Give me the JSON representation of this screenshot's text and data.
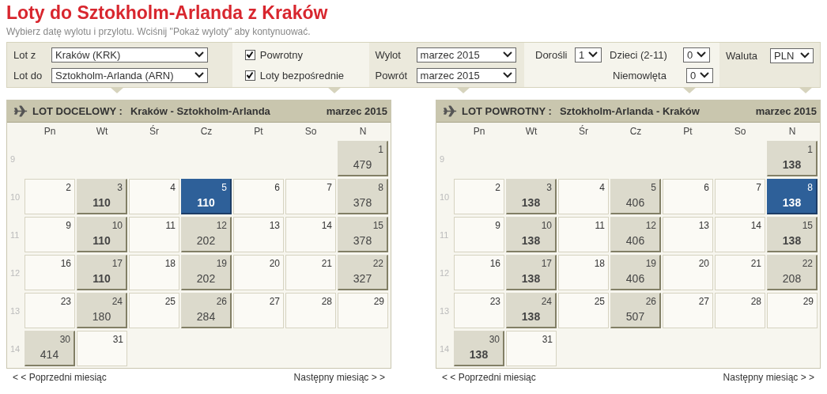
{
  "title": "Loty do Sztokholm-Arlanda z Kraków",
  "subtitle": "Wybierz datę wylotu i przylotu. Wciśnij \"Pokaż wyloty\" aby kontynuować.",
  "filters": {
    "route": [
      {
        "label": "Lot z",
        "value": "Kraków (KRK)"
      },
      {
        "label": "Lot do",
        "value": "Sztokholm-Arlanda (ARN)"
      }
    ],
    "options": [
      {
        "label": "Powrotny",
        "checked": true
      },
      {
        "label": "Loty bezpośrednie",
        "checked": true
      }
    ],
    "dates": [
      {
        "label": "Wylot",
        "value": "marzec 2015"
      },
      {
        "label": "Powrót",
        "value": "marzec 2015"
      }
    ],
    "passengers": [
      {
        "label": "Dorośli",
        "value": "1"
      },
      {
        "label": "Dzieci (2-11)",
        "value": "0"
      },
      {
        "label": "Niemowlęta",
        "value": "0"
      }
    ],
    "currency": {
      "label": "Waluta",
      "value": "PLN"
    }
  },
  "calendars": [
    {
      "heading": "LOT DOCELOWY :",
      "route": "Kraków - Sztokholm-Arlanda",
      "month": "marzec 2015",
      "weekdays": [
        "Pn",
        "Wt",
        "Śr",
        "Cz",
        "Pt",
        "So",
        "N"
      ],
      "weeks": [
        {
          "week": "9",
          "days": [
            {
              "kind": "blank"
            },
            {
              "kind": "blank"
            },
            {
              "kind": "blank"
            },
            {
              "kind": "blank"
            },
            {
              "kind": "blank"
            },
            {
              "kind": "blank"
            },
            {
              "kind": "flight",
              "day": "1",
              "price": "479",
              "cheapest": false,
              "selected": false
            }
          ]
        },
        {
          "week": "10",
          "days": [
            {
              "kind": "none",
              "day": "2"
            },
            {
              "kind": "flight",
              "day": "3",
              "price": "110",
              "cheapest": true,
              "selected": false
            },
            {
              "kind": "none",
              "day": "4"
            },
            {
              "kind": "flight",
              "day": "5",
              "price": "110",
              "cheapest": true,
              "selected": true
            },
            {
              "kind": "none",
              "day": "6"
            },
            {
              "kind": "none",
              "day": "7"
            },
            {
              "kind": "flight",
              "day": "8",
              "price": "378",
              "cheapest": false,
              "selected": false
            }
          ]
        },
        {
          "week": "11",
          "days": [
            {
              "kind": "none",
              "day": "9"
            },
            {
              "kind": "flight",
              "day": "10",
              "price": "110",
              "cheapest": true,
              "selected": false
            },
            {
              "kind": "none",
              "day": "11"
            },
            {
              "kind": "flight",
              "day": "12",
              "price": "202",
              "cheapest": false,
              "selected": false
            },
            {
              "kind": "none",
              "day": "13"
            },
            {
              "kind": "none",
              "day": "14"
            },
            {
              "kind": "flight",
              "day": "15",
              "price": "378",
              "cheapest": false,
              "selected": false
            }
          ]
        },
        {
          "week": "12",
          "days": [
            {
              "kind": "none",
              "day": "16"
            },
            {
              "kind": "flight",
              "day": "17",
              "price": "110",
              "cheapest": true,
              "selected": false
            },
            {
              "kind": "none",
              "day": "18"
            },
            {
              "kind": "flight",
              "day": "19",
              "price": "202",
              "cheapest": false,
              "selected": false
            },
            {
              "kind": "none",
              "day": "20"
            },
            {
              "kind": "none",
              "day": "21"
            },
            {
              "kind": "flight",
              "day": "22",
              "price": "327",
              "cheapest": false,
              "selected": false
            }
          ]
        },
        {
          "week": "13",
          "days": [
            {
              "kind": "none",
              "day": "23"
            },
            {
              "kind": "flight",
              "day": "24",
              "price": "180",
              "cheapest": false,
              "selected": false
            },
            {
              "kind": "none",
              "day": "25"
            },
            {
              "kind": "flight",
              "day": "26",
              "price": "284",
              "cheapest": false,
              "selected": false
            },
            {
              "kind": "none",
              "day": "27"
            },
            {
              "kind": "none",
              "day": "28"
            },
            {
              "kind": "none",
              "day": "29"
            }
          ]
        },
        {
          "week": "14",
          "days": [
            {
              "kind": "flight",
              "day": "30",
              "price": "414",
              "cheapest": false,
              "selected": false
            },
            {
              "kind": "none",
              "day": "31"
            }
          ]
        }
      ],
      "prev": "< < Poprzedni miesiąc",
      "next": "Następny miesiąc > >"
    },
    {
      "heading": "LOT POWROTNY :",
      "route": "Sztokholm-Arlanda - Kraków",
      "month": "marzec 2015",
      "weekdays": [
        "Pn",
        "Wt",
        "Śr",
        "Cz",
        "Pt",
        "So",
        "N"
      ],
      "weeks": [
        {
          "week": "9",
          "days": [
            {
              "kind": "blank"
            },
            {
              "kind": "blank"
            },
            {
              "kind": "blank"
            },
            {
              "kind": "blank"
            },
            {
              "kind": "blank"
            },
            {
              "kind": "blank"
            },
            {
              "kind": "flight",
              "day": "1",
              "price": "138",
              "cheapest": true,
              "selected": false
            }
          ]
        },
        {
          "week": "10",
          "days": [
            {
              "kind": "none",
              "day": "2"
            },
            {
              "kind": "flight",
              "day": "3",
              "price": "138",
              "cheapest": true,
              "selected": false
            },
            {
              "kind": "none",
              "day": "4"
            },
            {
              "kind": "flight",
              "day": "5",
              "price": "406",
              "cheapest": false,
              "selected": false
            },
            {
              "kind": "none",
              "day": "6"
            },
            {
              "kind": "none",
              "day": "7"
            },
            {
              "kind": "flight",
              "day": "8",
              "price": "138",
              "cheapest": true,
              "selected": true
            }
          ]
        },
        {
          "week": "11",
          "days": [
            {
              "kind": "none",
              "day": "9"
            },
            {
              "kind": "flight",
              "day": "10",
              "price": "138",
              "cheapest": true,
              "selected": false
            },
            {
              "kind": "none",
              "day": "11"
            },
            {
              "kind": "flight",
              "day": "12",
              "price": "406",
              "cheapest": false,
              "selected": false
            },
            {
              "kind": "none",
              "day": "13"
            },
            {
              "kind": "none",
              "day": "14"
            },
            {
              "kind": "flight",
              "day": "15",
              "price": "138",
              "cheapest": true,
              "selected": false
            }
          ]
        },
        {
          "week": "12",
          "days": [
            {
              "kind": "none",
              "day": "16"
            },
            {
              "kind": "flight",
              "day": "17",
              "price": "138",
              "cheapest": true,
              "selected": false
            },
            {
              "kind": "none",
              "day": "18"
            },
            {
              "kind": "flight",
              "day": "19",
              "price": "406",
              "cheapest": false,
              "selected": false
            },
            {
              "kind": "none",
              "day": "20"
            },
            {
              "kind": "none",
              "day": "21"
            },
            {
              "kind": "flight",
              "day": "22",
              "price": "208",
              "cheapest": false,
              "selected": false
            }
          ]
        },
        {
          "week": "13",
          "days": [
            {
              "kind": "none",
              "day": "23"
            },
            {
              "kind": "flight",
              "day": "24",
              "price": "138",
              "cheapest": true,
              "selected": false
            },
            {
              "kind": "none",
              "day": "25"
            },
            {
              "kind": "flight",
              "day": "26",
              "price": "507",
              "cheapest": false,
              "selected": false
            },
            {
              "kind": "none",
              "day": "27"
            },
            {
              "kind": "none",
              "day": "28"
            },
            {
              "kind": "none",
              "day": "29"
            }
          ]
        },
        {
          "week": "14",
          "days": [
            {
              "kind": "flight",
              "day": "30",
              "price": "138",
              "cheapest": true,
              "selected": false
            },
            {
              "kind": "none",
              "day": "31"
            }
          ]
        }
      ],
      "prev": "< < Poprzedni miesiąc",
      "next": "Następny miesiąc > >"
    }
  ]
}
